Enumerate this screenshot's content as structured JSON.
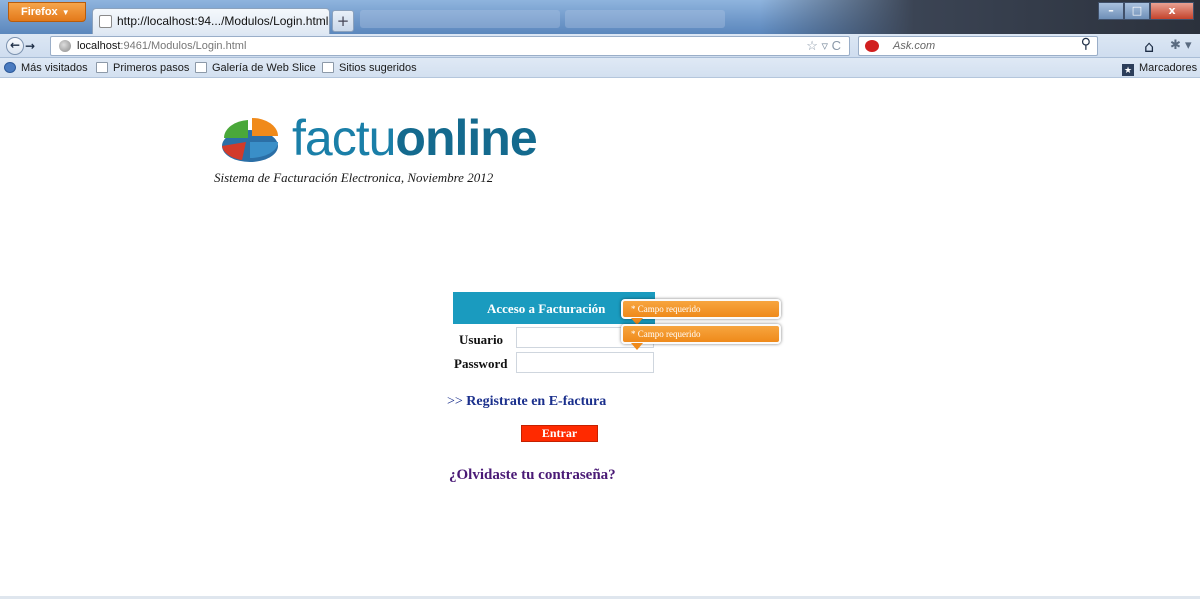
{
  "browser": {
    "menu_button": "Firefox",
    "tab_title": "http://localhost:94.../Modulos/Login.html",
    "new_tab": "+",
    "url_host": "localhost",
    "url_rest": ":9461/Modulos/Login.html",
    "search_placeholder": "Ask.com",
    "window_controls": {
      "minimize": "–",
      "maximize": "□",
      "close": "x"
    }
  },
  "bookmarks": {
    "items": [
      {
        "label": "Más visitados",
        "icon": "most-visited-icon"
      },
      {
        "label": "Primeros pasos",
        "icon": "page-icon"
      },
      {
        "label": "Galería de Web Slice",
        "icon": "page-icon"
      },
      {
        "label": "Sitios sugeridos",
        "icon": "page-icon"
      }
    ],
    "right_label": "Marcadores"
  },
  "page": {
    "logo": {
      "text_light": "factu",
      "text_bold": "online"
    },
    "subtitle": "Sistema de Facturación Electronica, Noviembre 2012",
    "login": {
      "header": "Acceso a Facturación",
      "username_label": "Usuario",
      "username_value": "",
      "password_label": "Password",
      "password_value": "",
      "tooltip_username": "* Campo requerido",
      "tooltip_password": "* Campo requerido"
    },
    "register_prefix": ">>",
    "register_link": "Registrate en E-factura",
    "submit_button": "Entrar",
    "forgot_link": "¿Olvidaste tu contraseña?"
  },
  "colors": {
    "header_bg": "#1a9bbf",
    "tooltip_bg": "#ef8a1a",
    "submit_bg": "#ff2a00",
    "link_color": "#1a2f8c",
    "forgot_color": "#4a1a76",
    "logo_color": "#1a7fa8"
  }
}
